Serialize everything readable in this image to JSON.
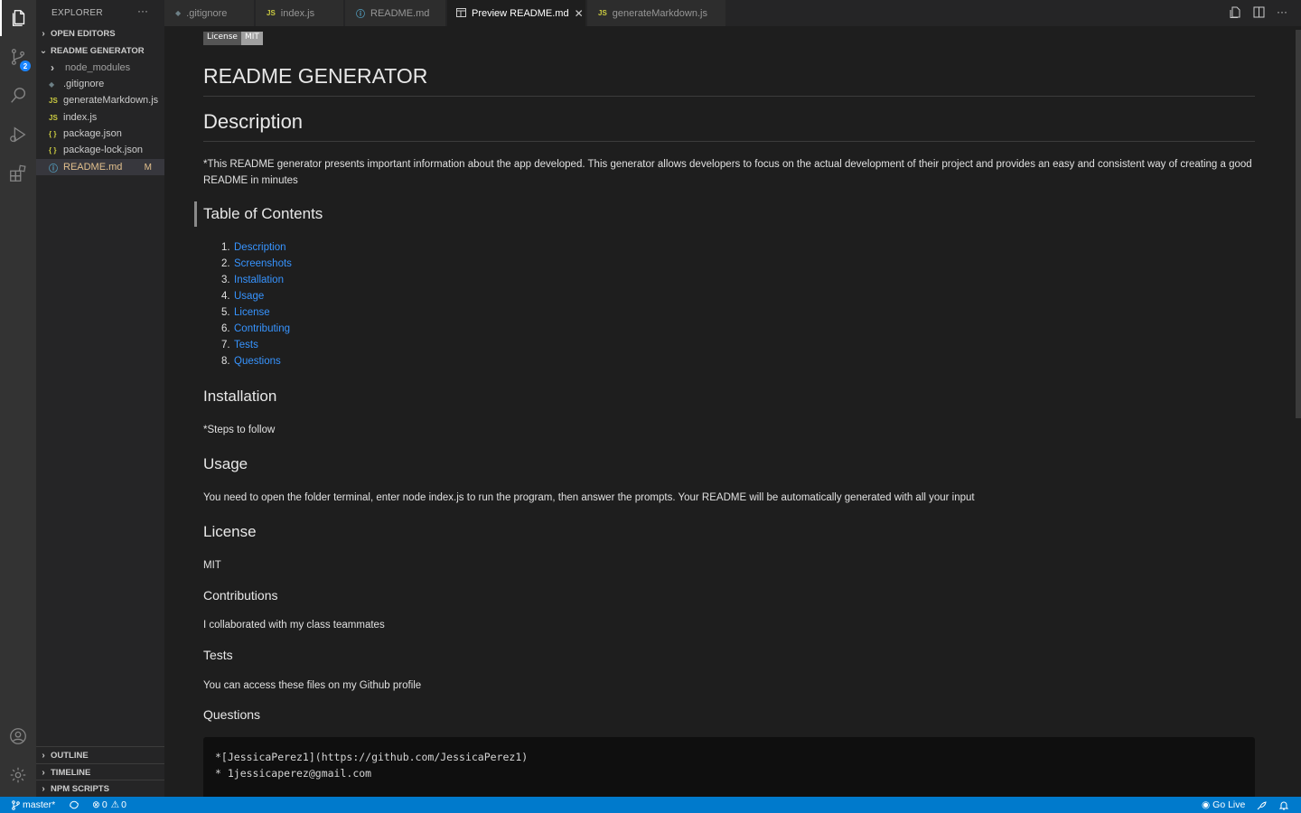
{
  "activity": {
    "scm_badge": "2"
  },
  "sidebar": {
    "title": "EXPLORER",
    "more": "···",
    "open_editors": "OPEN EDITORS",
    "project": "README GENERATOR",
    "items": [
      {
        "label": "node_modules",
        "icon": "chevron-right-icon",
        "type": "folder"
      },
      {
        "label": ".gitignore",
        "icon": "git-icon",
        "type": "file"
      },
      {
        "label": "generateMarkdown.js",
        "icon": "js-icon",
        "type": "file"
      },
      {
        "label": "index.js",
        "icon": "js-icon",
        "type": "file"
      },
      {
        "label": "package.json",
        "icon": "json-icon",
        "type": "file"
      },
      {
        "label": "package-lock.json",
        "icon": "json-icon",
        "type": "file"
      },
      {
        "label": "README.md",
        "icon": "info-icon",
        "type": "file",
        "status": "M"
      }
    ],
    "outline": "OUTLINE",
    "timeline": "TIMELINE",
    "npm_scripts": "NPM SCRIPTS"
  },
  "tabs": [
    {
      "label": ".gitignore",
      "icon": "git-icon"
    },
    {
      "label": "index.js",
      "icon": "js-icon"
    },
    {
      "label": "README.md",
      "icon": "info-icon"
    },
    {
      "label": "Preview README.md",
      "icon": "preview-icon",
      "active": true
    },
    {
      "label": "generateMarkdown.js",
      "icon": "js-icon"
    }
  ],
  "icons": {
    "js": "JS",
    "json": "{ }",
    "git": "◆",
    "info": "ⓘ",
    "close": "✕",
    "chevron_right": "›",
    "chevron_down": "⌄"
  },
  "preview": {
    "badge_left": "License",
    "badge_right": "MIT",
    "title": "README GENERATOR",
    "description_heading": "Description",
    "description_text": "*This README generator presents important information about the app developed. This generator allows developers to focus on the actual development of their project and provides an easy and consistent way of creating a good README in minutes",
    "toc_heading": "Table of Contents",
    "toc": [
      {
        "num": "1.",
        "label": "Description"
      },
      {
        "num": "2.",
        "label": "Screenshots"
      },
      {
        "num": "3.",
        "label": "Installation"
      },
      {
        "num": "4.",
        "label": "Usage"
      },
      {
        "num": "5.",
        "label": "License"
      },
      {
        "num": "6.",
        "label": "Contributing"
      },
      {
        "num": "7.",
        "label": "Tests"
      },
      {
        "num": "8.",
        "label": "Questions"
      }
    ],
    "installation_heading": "Installation",
    "installation_text": "*Steps to follow",
    "usage_heading": "Usage",
    "usage_text": "You need to open the folder terminal, enter node index.js to run the program, then answer the prompts. Your README will be automatically generated with all your input",
    "license_heading": "License",
    "license_text": "MIT",
    "contributions_heading": "Contributions",
    "contributions_text": "I collaborated with my class teammates",
    "tests_heading": "Tests",
    "tests_text": "You can access these files on my Github profile",
    "questions_heading": "Questions",
    "code_line1": "*[JessicaPerez1](https://github.com/JessicaPerez1)",
    "code_line2": "* 1jessicaperez@gmail.com"
  },
  "status": {
    "branch": "master*",
    "errors": "0",
    "warnings": "0",
    "go_live": "Go Live"
  },
  "colors": {
    "accent": "#007acc",
    "link": "#3794ff",
    "modified": "#e2c08d"
  }
}
